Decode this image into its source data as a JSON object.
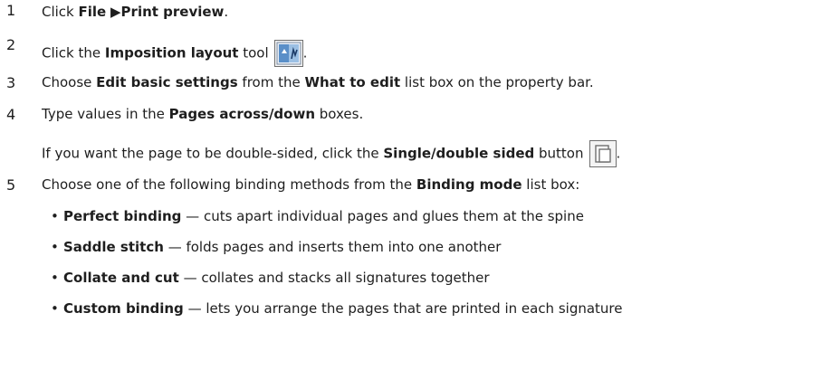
{
  "steps": [
    {
      "num": "1",
      "pre": "Click ",
      "b1": "File",
      "sep": "▶",
      "b2": "Print preview",
      "post": "."
    },
    {
      "num": "2",
      "pre": "Click the ",
      "b1": "Imposition layout",
      "post": " tool",
      "trail": "."
    },
    {
      "num": "3",
      "pre": "Choose ",
      "b1": "Edit basic settings",
      "mid": " from the ",
      "b2": "What to edit",
      "post": " list box on the property bar."
    },
    {
      "num": "4",
      "pre": "Type values in the ",
      "b1": "Pages across/down",
      "post": " boxes."
    },
    {
      "note": {
        "pre": "If you want the page to be double-sided, click the ",
        "b1": "Single/double sided",
        "post": " button",
        "trail": "."
      }
    },
    {
      "num": "5",
      "pre": "Choose one of the following binding methods from the ",
      "b1": "Binding mode",
      "post": " list box:"
    }
  ],
  "bullets": [
    {
      "label": "Perfect binding",
      "text": " — cuts apart individual pages and glues them at the spine"
    },
    {
      "label": "Saddle stitch",
      "text": " — folds pages and inserts them into one another"
    },
    {
      "label": "Collate and cut",
      "text": " — collates and stacks all signatures together"
    },
    {
      "label": "Custom binding",
      "text": " — lets you arrange the pages that are printed in each signature"
    }
  ],
  "bullet_glyph": "•",
  "icons": {
    "imposition": "imposition-layout-icon",
    "single_double": "single-double-sided-icon"
  }
}
